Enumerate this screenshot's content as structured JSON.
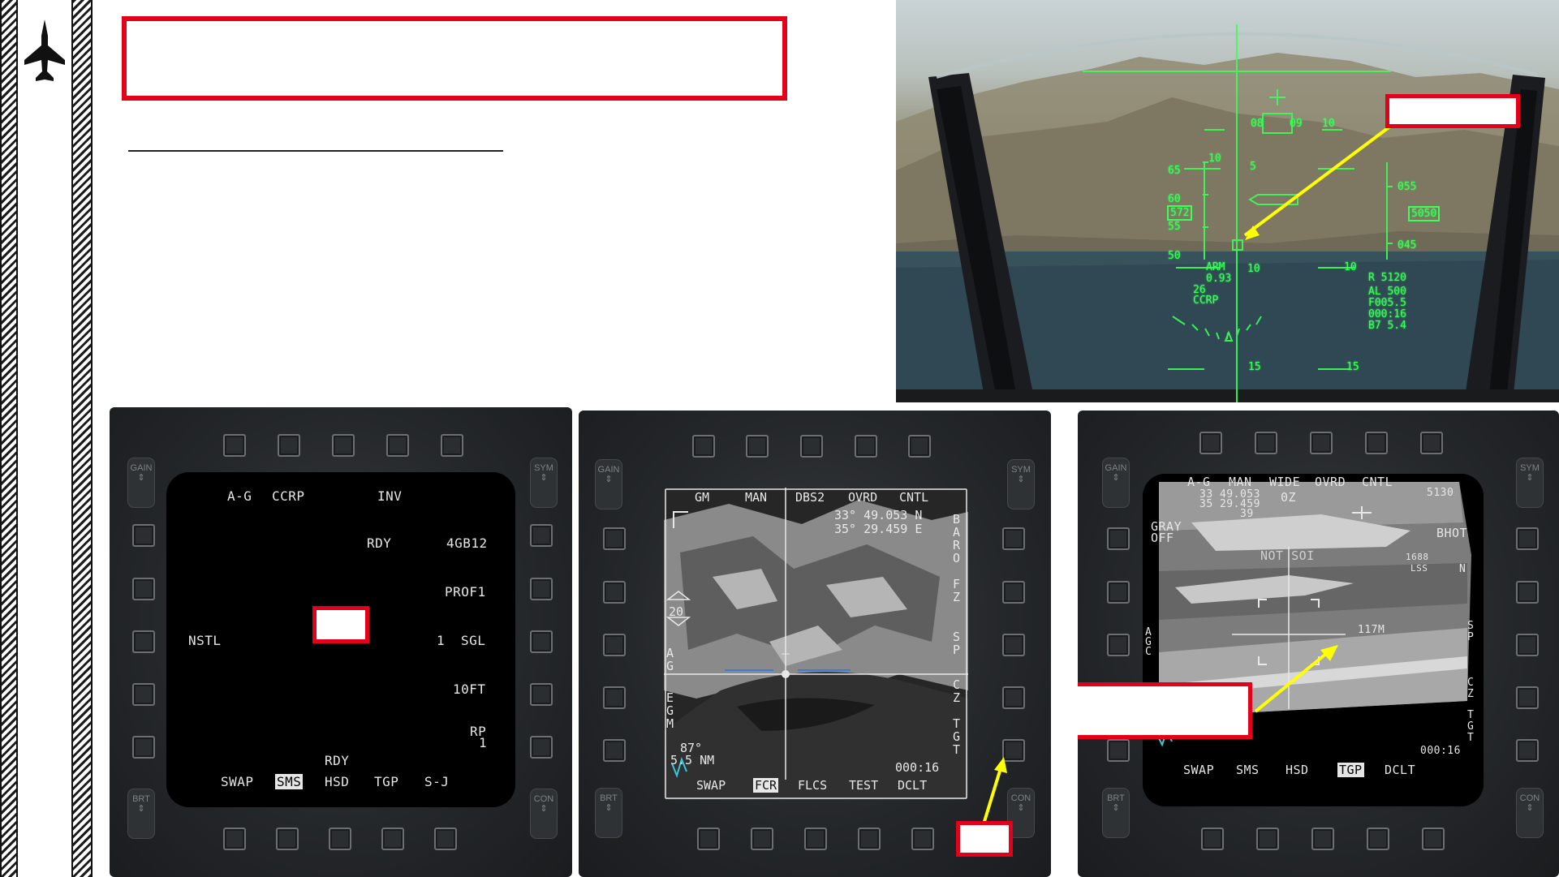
{
  "sidebar": {
    "logo_icon": "jet-silhouette-icon"
  },
  "callouts": {
    "title_box": "",
    "hud_callout": "",
    "sms_callout": "",
    "fcr_callout": "",
    "tgp_callout": ""
  },
  "hud": {
    "speed_scale": [
      "65",
      "60",
      "55",
      "50"
    ],
    "speed_box": "572",
    "alt_scale": [
      "055",
      "045"
    ],
    "alt_box": "5050",
    "heading": [
      "08",
      "09",
      "10"
    ],
    "pitch_10_upper": "10",
    "pitch_5": "5",
    "pitch_10": "10",
    "pitch_15": "15",
    "arm": "ARM",
    "g_value": "0.93",
    "ccrp_line1": "26",
    "ccrp": "CCRP",
    "range_box": "R 5120",
    "al": "AL  500",
    "foo": "F005.5",
    "time": "000:16",
    "b7": "B7 5.4"
  },
  "sms": {
    "mode": "A-G",
    "submode": "CCRP",
    "inv": "INV",
    "rdy_upper": "RDY",
    "weapon": "4GB12",
    "profile": "PROF1",
    "nstl": "NSTL",
    "qty": "1",
    "release": "SGL",
    "spacing": "10FT",
    "rp": "RP",
    "rp_val": "1",
    "rdy_lower": "RDY",
    "bottom": [
      "SWAP",
      "SMS",
      "HSD",
      "TGP",
      "S-J"
    ],
    "gain": "GAIN",
    "sym": "SYM",
    "brt": "BRT",
    "con": "CON"
  },
  "fcr": {
    "top": [
      "GM",
      "MAN",
      "DBS2",
      "OVRD",
      "CNTL"
    ],
    "lat": "33° 49.053 N",
    "lon": "35° 29.459 E",
    "range": "20",
    "az": "87°",
    "dist": "5.5 NM",
    "clock": "000:16",
    "right": [
      "B",
      "A",
      "R",
      "O",
      "F",
      "Z",
      "S",
      "P",
      "C",
      "Z",
      "T",
      "G",
      "T"
    ],
    "left": [
      "A",
      "G",
      "E",
      "G",
      "M"
    ],
    "bottom": [
      "SWAP",
      "FCR",
      "FLCS",
      "TEST",
      "DCLT"
    ],
    "gain": "GAIN",
    "sym": "SYM",
    "brt": "BRT",
    "con": "CON"
  },
  "tgp": {
    "top": [
      "A-G",
      "MAN",
      "WIDE",
      "OVRD",
      "CNTL"
    ],
    "lat": "33 49.053",
    "lon": "35 29.459",
    "elev": "39",
    "oz": "0Z",
    "code": "5130",
    "gray": "GRAY",
    "off": "OFF",
    "bhot": "BHOT",
    "not_soi": "NOT SOI",
    "lss_num": "1688",
    "lss": "LSS",
    "n": "N",
    "dist": "117M",
    "clock": "000:16",
    "bottom": [
      "SWAP",
      "SMS",
      "HSD",
      "TGP",
      "DCLT"
    ],
    "left": [
      "A",
      "G",
      "C"
    ],
    "right": [
      "S",
      "P",
      "C",
      "Z",
      "T",
      "G",
      "T"
    ],
    "gain": "GAIN",
    "sym": "SYM",
    "brt": "BRT",
    "con": "CON"
  },
  "colors": {
    "callout_red": "#e2001a",
    "hud_green": "#3cff5a",
    "arrow_yellow": "#ffff00"
  }
}
